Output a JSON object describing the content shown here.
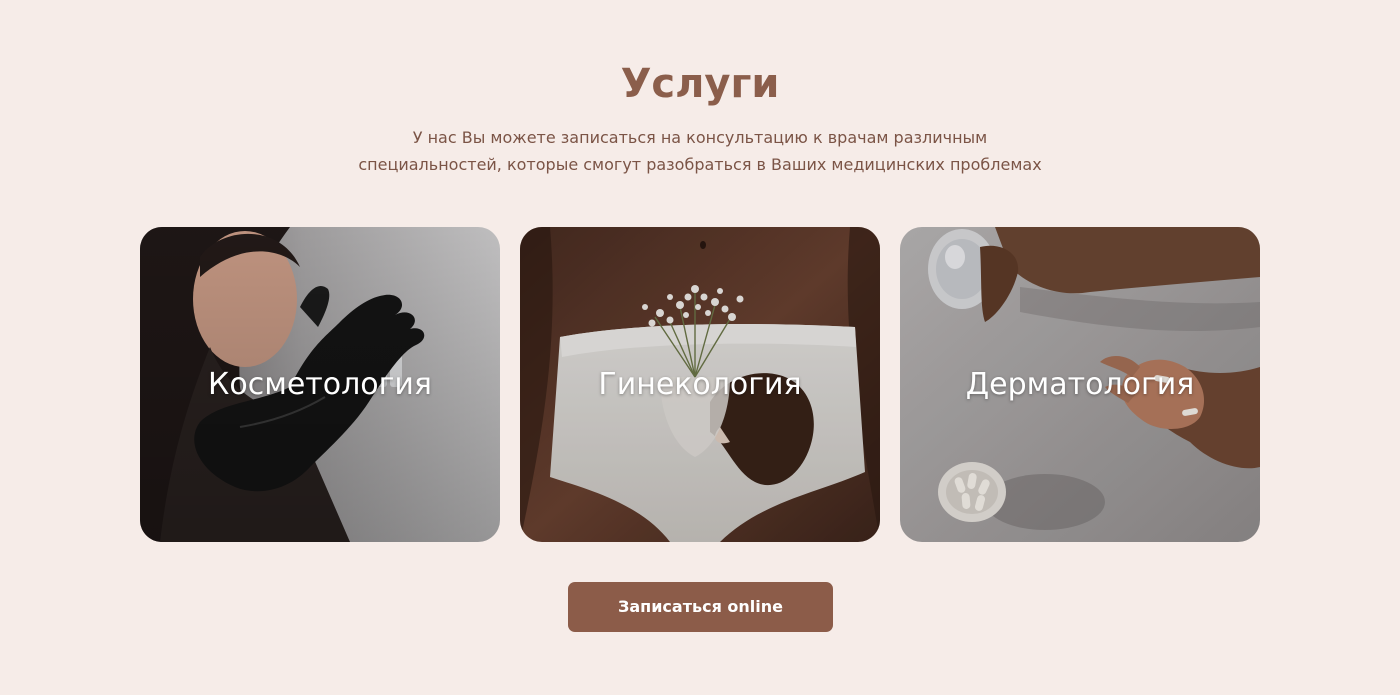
{
  "services": {
    "title": "Услуги",
    "subtitle_lines": [
      "У нас Вы можете записаться на консультацию к врачам различным",
      "специальностей, которые смогут разобраться в Ваших медицинских проблемах"
    ],
    "cards": [
      {
        "label": "Косметология",
        "image": "cosmetology-photo"
      },
      {
        "label": "Гинекология",
        "image": "gynecology-photo"
      },
      {
        "label": "Дерматология",
        "image": "dermatology-photo"
      }
    ],
    "cta_label": "Записаться online"
  },
  "colors": {
    "background": "#f6ece8",
    "title": "#8b5e4b",
    "text": "#7b5446",
    "button": "#8c5c49",
    "button_text": "#ffffff"
  }
}
